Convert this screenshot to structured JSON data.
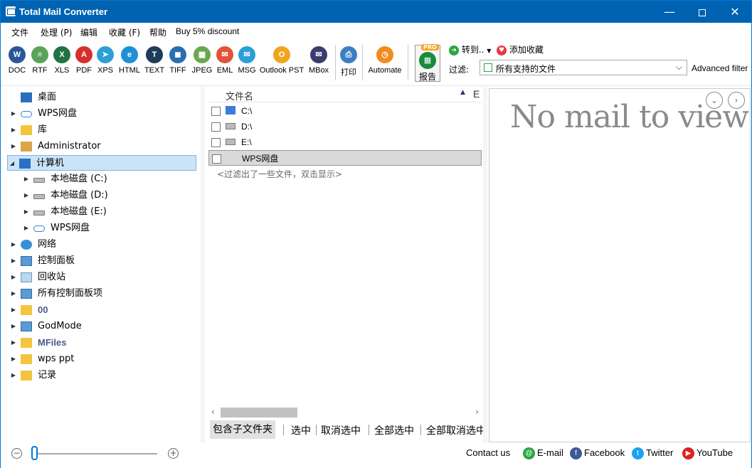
{
  "window": {
    "title": "Total Mail Converter"
  },
  "menu": [
    "文件",
    "处理 (P)",
    "编辑",
    "收藏 (F)",
    "帮助",
    "Buy 5% discount"
  ],
  "toolbar": {
    "buttons": [
      {
        "label": "DOC",
        "icon": "doc-icon",
        "glyph": "W",
        "color": "#2b579a"
      },
      {
        "label": "RTF",
        "icon": "rtf-icon",
        "glyph": "≡",
        "color": "#5ba35b"
      },
      {
        "label": "XLS",
        "icon": "xls-icon",
        "glyph": "X",
        "color": "#217346"
      },
      {
        "label": "PDF",
        "icon": "pdf-icon",
        "glyph": "A",
        "color": "#d62f2f"
      },
      {
        "label": "XPS",
        "icon": "xps-icon",
        "glyph": "➤",
        "color": "#2d9fd8"
      },
      {
        "label": "HTML",
        "icon": "html-icon",
        "glyph": "e",
        "color": "#1e90d6"
      },
      {
        "label": "TEXT",
        "icon": "text-icon",
        "glyph": "T",
        "color": "#1f3b5a"
      },
      {
        "label": "TIFF",
        "icon": "tiff-icon",
        "glyph": "◼",
        "color": "#2a6fb0"
      },
      {
        "label": "JPEG",
        "icon": "jpeg-icon",
        "glyph": "▦",
        "color": "#6aa84f"
      },
      {
        "label": "EML",
        "icon": "eml-icon",
        "glyph": "✉",
        "color": "#e0533a"
      },
      {
        "label": "MSG",
        "icon": "msg-icon",
        "glyph": "✉",
        "color": "#2a9fd8"
      },
      {
        "label": "Outlook PST",
        "icon": "outlook-pst-icon",
        "glyph": "O",
        "color": "#f0a520"
      },
      {
        "label": "MBox",
        "icon": "mbox-icon",
        "glyph": "✉",
        "color": "#3b3b6e"
      },
      {
        "label": "打印",
        "icon": "print-icon",
        "glyph": "⎙",
        "color": "#3a7fc2"
      },
      {
        "label": "Automate",
        "icon": "automate-icon",
        "glyph": "◷",
        "color": "#f08c1e"
      }
    ],
    "report": {
      "label": "报告",
      "badge": "PRO"
    },
    "goto_label": "转到..",
    "favorite_label": "添加收藏",
    "filter_label": "过滤:",
    "filter_value": "所有支持的文件",
    "advanced_filter": "Advanced filter"
  },
  "tree": [
    {
      "label": "桌面",
      "icon": "desktop-icon",
      "level": 0,
      "expander": "",
      "bold": false,
      "selected": false
    },
    {
      "label": "WPS网盘",
      "icon": "cloud-icon",
      "level": 0,
      "expander": "▶",
      "bold": false,
      "selected": false
    },
    {
      "label": "库",
      "icon": "library-icon",
      "level": 0,
      "expander": "▶",
      "bold": false,
      "selected": false
    },
    {
      "label": "Administrator",
      "icon": "user-folder-icon",
      "level": 0,
      "expander": "▶",
      "bold": false,
      "selected": false
    },
    {
      "label": "计算机",
      "icon": "computer-icon",
      "level": 0,
      "expander": "◢",
      "bold": false,
      "selected": true
    },
    {
      "label": "本地磁盘 (C:)",
      "icon": "drive-c-icon",
      "level": 1,
      "expander": "▶",
      "bold": false,
      "selected": false
    },
    {
      "label": "本地磁盘 (D:)",
      "icon": "drive-icon",
      "level": 1,
      "expander": "▶",
      "bold": false,
      "selected": false
    },
    {
      "label": "本地磁盘 (E:)",
      "icon": "drive-icon",
      "level": 1,
      "expander": "▶",
      "bold": false,
      "selected": false
    },
    {
      "label": "WPS网盘",
      "icon": "cloud-icon",
      "level": 1,
      "expander": "▶",
      "bold": false,
      "selected": false
    },
    {
      "label": "网络",
      "icon": "network-icon",
      "level": 0,
      "expander": "▶",
      "bold": false,
      "selected": false
    },
    {
      "label": "控制面板",
      "icon": "control-panel-icon",
      "level": 0,
      "expander": "▶",
      "bold": false,
      "selected": false
    },
    {
      "label": "回收站",
      "icon": "recycle-bin-icon",
      "level": 0,
      "expander": "▶",
      "bold": false,
      "selected": false
    },
    {
      "label": "所有控制面板项",
      "icon": "control-panel-icon",
      "level": 0,
      "expander": "▶",
      "bold": false,
      "selected": false
    },
    {
      "label": "00",
      "icon": "folder-icon",
      "level": 0,
      "expander": "▶",
      "bold": true,
      "selected": false
    },
    {
      "label": "GodMode",
      "icon": "control-panel-icon",
      "level": 0,
      "expander": "▶",
      "bold": false,
      "selected": false
    },
    {
      "label": "MFiles",
      "icon": "folder-icon",
      "level": 0,
      "expander": "▶",
      "bold": true,
      "selected": false
    },
    {
      "label": "wps ppt",
      "icon": "folder-icon",
      "level": 0,
      "expander": "▶",
      "bold": false,
      "selected": false
    },
    {
      "label": "记录",
      "icon": "folder-icon",
      "level": 0,
      "expander": "▶",
      "bold": false,
      "selected": false
    }
  ],
  "filelist": {
    "column": "文件名",
    "column2": "E",
    "rows": [
      {
        "name": "C:\\",
        "icon": "drive-c-icon",
        "selected": false
      },
      {
        "name": "D:\\",
        "icon": "drive-icon",
        "selected": false
      },
      {
        "name": "E:\\",
        "icon": "drive-icon",
        "selected": false
      },
      {
        "name": "WPS网盘",
        "icon": "cloud-icon",
        "selected": true
      }
    ],
    "hint": "<过滤出了一些文件，双击显示>"
  },
  "actions": [
    "包含子文件夹",
    "选中",
    "取消选中",
    "全部选中",
    "全部取消选中"
  ],
  "preview": {
    "message": "No mail to view"
  },
  "status": {
    "contact": "Contact us",
    "links": [
      {
        "label": "E-mail",
        "icon": "email-icon",
        "glyph": "@",
        "color": "#2aa541"
      },
      {
        "label": "Facebook",
        "icon": "facebook-icon",
        "glyph": "f",
        "color": "#3b5998"
      },
      {
        "label": "Twitter",
        "icon": "twitter-icon",
        "glyph": "t",
        "color": "#1da1f2"
      },
      {
        "label": "YouTube",
        "icon": "youtube-icon",
        "glyph": "▶",
        "color": "#e02020"
      }
    ]
  }
}
